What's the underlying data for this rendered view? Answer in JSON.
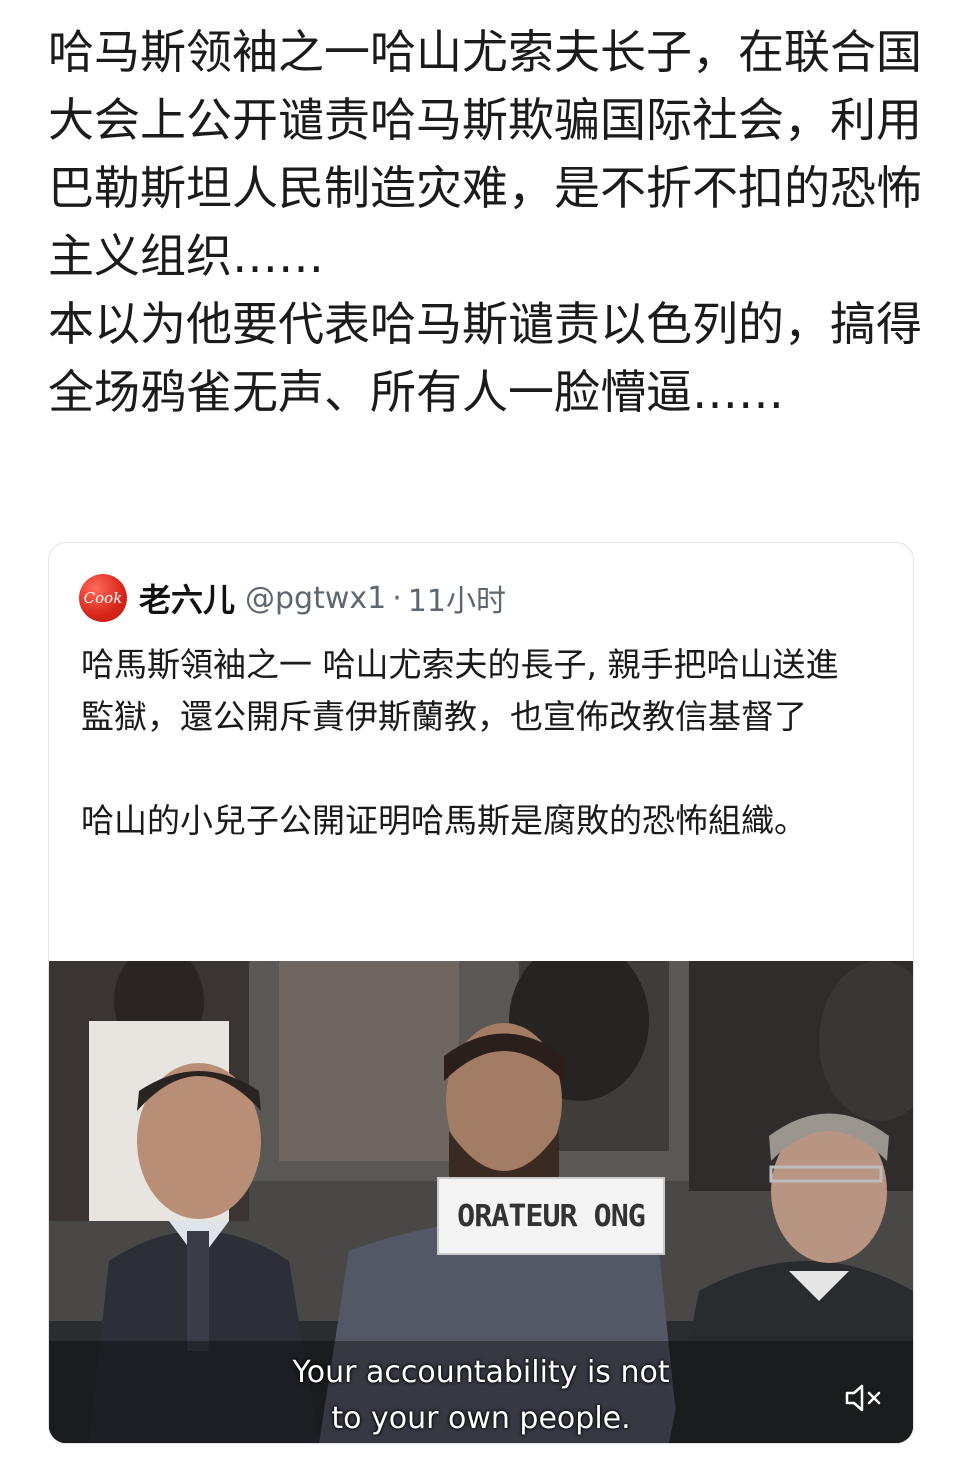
{
  "post": {
    "paragraphs": [
      "哈马斯领袖之一哈山尤索夫长子，在联合国大会上公开谴责哈马斯欺骗国际社会，利用巴勒斯坦人民制造灾难，是不折不扣的恐怖主义组织……",
      "本以为他要代表哈马斯谴责以色列的，搞得全场鸦雀无声、所有人一脸懵逼……"
    ]
  },
  "quote": {
    "avatar_text": "Cook",
    "name": "老六儿",
    "handle": "@pgtwx1",
    "dot": "·",
    "time": "11小时",
    "body": [
      "哈馬斯領袖之一 哈山尤索夫的長子, 親手把哈山送進監獄，還公開斥責伊斯蘭教，也宣佈改教信基督了",
      "哈山的小兒子公開证明哈馬斯是腐敗的恐怖組織。"
    ],
    "video": {
      "nameplate": "ORATEUR ONG",
      "caption_line1": "Your accountability is not",
      "caption_line2": "to your own people.",
      "mute_icon": "speaker-muted-icon"
    }
  }
}
